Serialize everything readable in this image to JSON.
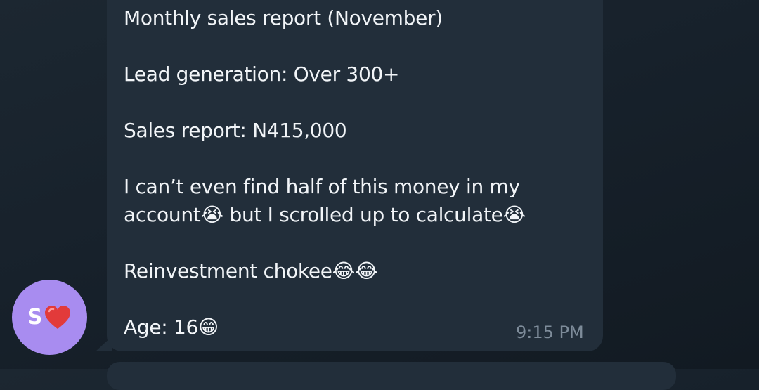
{
  "message": {
    "text": "Monthly sales report (November)\n\nLead generation: Over 300+\n\nSales report: N415,000\n\nI can’t even find half of this money in my account😭 but I scrolled up to calculate😭\n\nReinvestment chokee😂😂\n\nAge: 16😁",
    "time": "9:15 PM"
  },
  "sender": {
    "avatar_text": "S",
    "avatar_emoji": "heart-icon",
    "avatar_color": "#a88cf0"
  },
  "colors": {
    "background": "#17212b",
    "bubble": "#222e3a",
    "text": "#f2f5f8",
    "time": "#7e8c9a"
  }
}
